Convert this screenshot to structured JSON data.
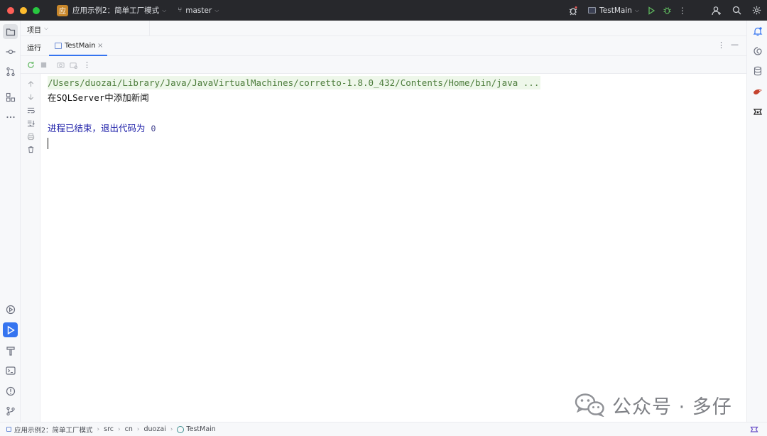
{
  "titlebar": {
    "project_badge": "应",
    "project_name": "应用示例2：简单工厂模式",
    "branch": "master",
    "run_config": "TestMain",
    "colors": {
      "close": "#ff5f57",
      "minimize": "#febc2e",
      "zoom": "#28c840",
      "badge": "#c8872b"
    }
  },
  "project_panel": {
    "label": "项目"
  },
  "run_panel": {
    "title": "运行",
    "tab_label": "TestMain",
    "tab_close": "×"
  },
  "console": {
    "command_line": "/Users/duozai/Library/Java/JavaVirtualMachines/corretto-1.8.0_432/Contents/Home/bin/java ...",
    "output_prefix": "在",
    "output_mono": "SQLServer",
    "output_suffix": "中添加新闻",
    "exit_message": "进程已结束，退出代码为",
    "exit_code": "0"
  },
  "watermark": {
    "text": "公众号 · 多仔"
  },
  "statusbar": {
    "crumbs": [
      "应用示例2：简单工厂模式",
      "src",
      "cn",
      "duozai",
      "TestMain"
    ]
  },
  "icons": {
    "left": [
      "folder-icon",
      "commit-icon",
      "pull-request-icon",
      "structure-icon",
      "more-icon",
      "services-icon",
      "run-icon",
      "build-icon",
      "terminal-icon",
      "problems-icon",
      "git-icon"
    ],
    "right": [
      "notifications-icon",
      "ai-assistant-icon",
      "database-icon",
      "maven-icon",
      "copilot-icon"
    ]
  }
}
